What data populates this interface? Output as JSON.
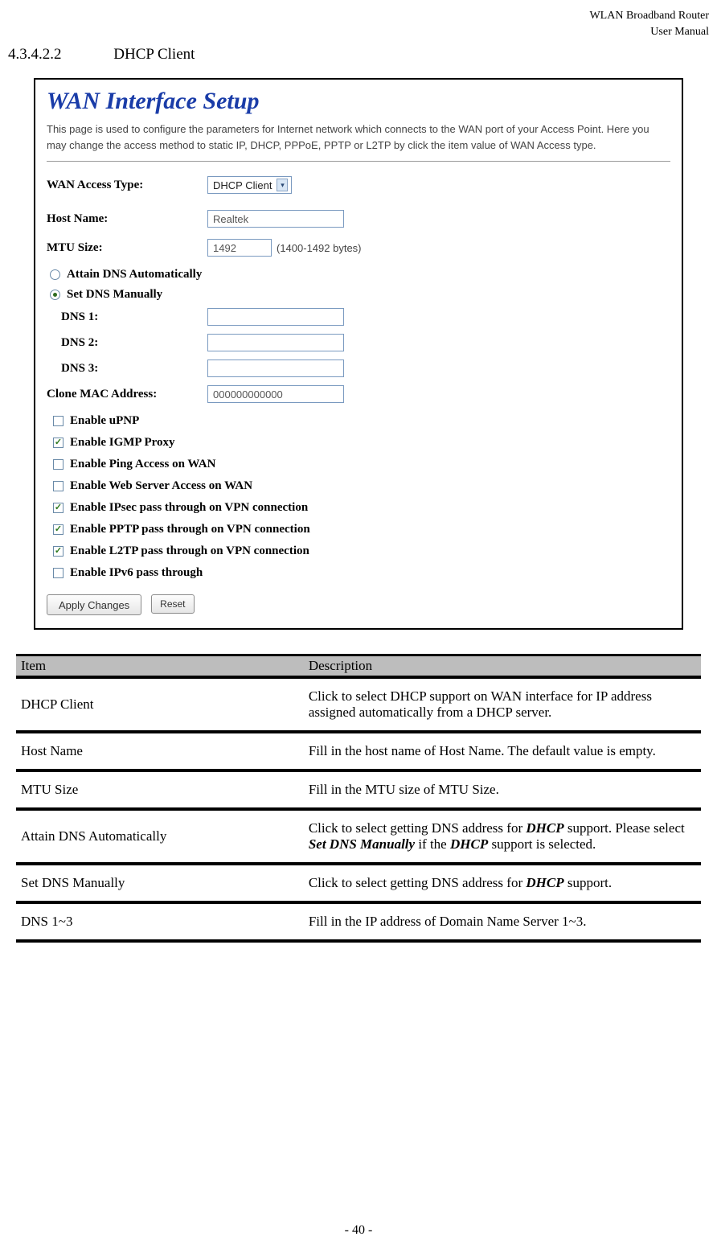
{
  "header": {
    "line1": "WLAN  Broadband  Router",
    "line2": "User  Manual"
  },
  "section": {
    "number": "4.3.4.2.2",
    "title": "DHCP Client"
  },
  "wan": {
    "title": "WAN Interface Setup",
    "desc": "This page is used to configure the parameters for Internet network which connects to the WAN port of your Access Point. Here you may change the access method to static IP, DHCP, PPPoE, PPTP or L2TP by click the item value of WAN Access type."
  },
  "form": {
    "access_type_label": "WAN Access Type:",
    "access_type_value": "DHCP Client",
    "host_name_label": "Host Name:",
    "host_name_value": "Realtek",
    "mtu_label": "MTU Size:",
    "mtu_value": "1492",
    "mtu_hint": "(1400-1492 bytes)",
    "dns_auto_label": "Attain DNS Automatically",
    "dns_manual_label": "Set DNS Manually",
    "dns1_label": "DNS 1:",
    "dns2_label": "DNS 2:",
    "dns3_label": "DNS 3:",
    "clone_label": "Clone MAC Address:",
    "clone_value": "000000000000",
    "opts": {
      "upnp": "Enable uPNP",
      "igmp": "Enable IGMP Proxy",
      "ping": "Enable Ping Access on WAN",
      "web": "Enable Web Server Access on WAN",
      "ipsec": "Enable IPsec pass through on VPN connection",
      "pptp": "Enable PPTP pass through on VPN connection",
      "l2tp": "Enable L2TP pass through on VPN connection",
      "ipv6": "Enable IPv6 pass through"
    },
    "apply": "Apply Changes",
    "reset": "Reset"
  },
  "table": {
    "head_item": "Item",
    "head_desc": "Description",
    "rows": [
      {
        "item": "DHCP Client",
        "desc": "Click to select DHCP support on WAN interface for IP address assigned automatically from a DHCP server."
      },
      {
        "item": "Host Name",
        "desc": "Fill in the host name of Host Name. The default value is empty."
      },
      {
        "item": "MTU Size",
        "desc": "Fill in the MTU size of MTU Size."
      },
      {
        "item": "Attain DNS Automatically",
        "desc_html": "Click to select getting DNS address for <span class='italic-bold'>DHCP</span> support. Please select <span class='italic-bold'>Set DNS Manually</span> if the <span class='italic-bold'>DHCP</span> support is selected."
      },
      {
        "item": "Set DNS Manually",
        "desc_html": "Click to select getting DNS address for <span class='italic-bold'>DHCP</span> support."
      },
      {
        "item": "DNS 1~3",
        "desc": "Fill in the IP address of Domain Name Server 1~3."
      }
    ]
  },
  "footer": "- 40 -"
}
